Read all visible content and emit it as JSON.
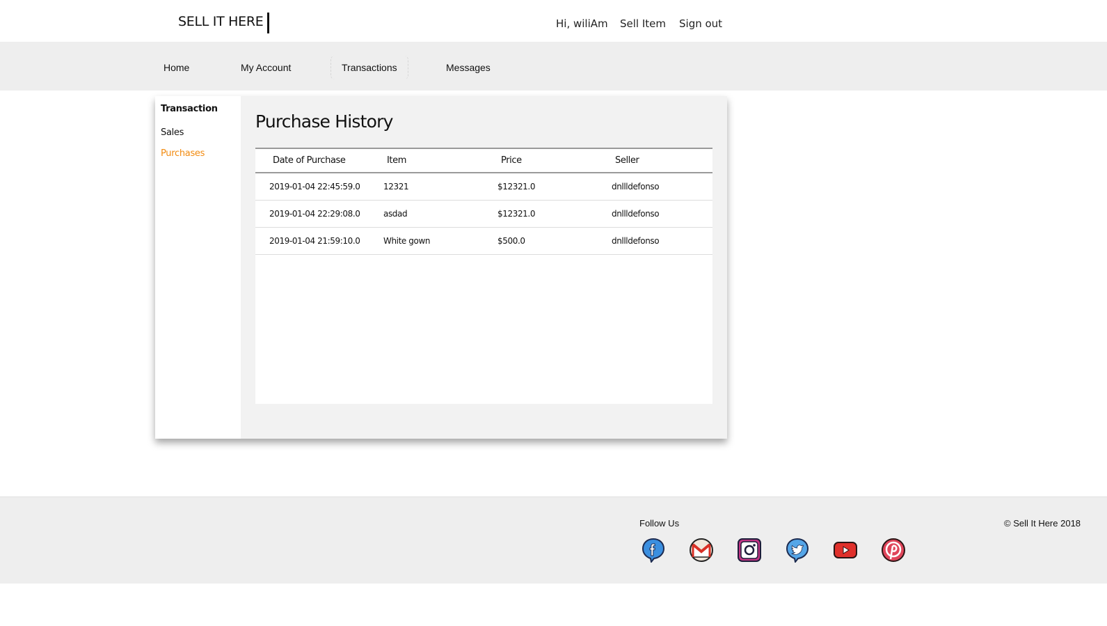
{
  "header": {
    "brand": "SELL IT HERE",
    "greeting": "Hi, wiliAm",
    "sell_item": "Sell Item",
    "sign_out": "Sign out"
  },
  "nav": {
    "items": [
      {
        "label": "Home"
      },
      {
        "label": "My Account"
      },
      {
        "label": "Transactions"
      },
      {
        "label": "Messages"
      }
    ],
    "active": "Transactions"
  },
  "sidebar": {
    "title": "Transaction",
    "items": [
      {
        "label": "Sales"
      },
      {
        "label": "Purchases"
      }
    ],
    "active": "Purchases",
    "active_color": "#f28b10"
  },
  "main": {
    "title": "Purchase History",
    "table": {
      "columns": [
        "Date of Purchase",
        "Item",
        "Price",
        "Seller"
      ],
      "rows": [
        [
          "2019-01-04 22:45:59.0",
          "12321",
          "$12321.0",
          "dnllldefonso"
        ],
        [
          "2019-01-04 22:29:08.0",
          "asdad",
          "$12321.0",
          "dnllldefonso"
        ],
        [
          "2019-01-04 21:59:10.0",
          "White gown",
          "$500.0",
          "dnllldefonso"
        ]
      ]
    }
  },
  "footer": {
    "follow_label": "Follow Us",
    "copyright": "© Sell It Here 2018",
    "social": [
      "facebook-icon",
      "gmail-icon",
      "instagram-icon",
      "twitter-icon",
      "youtube-icon",
      "pinterest-icon"
    ]
  }
}
